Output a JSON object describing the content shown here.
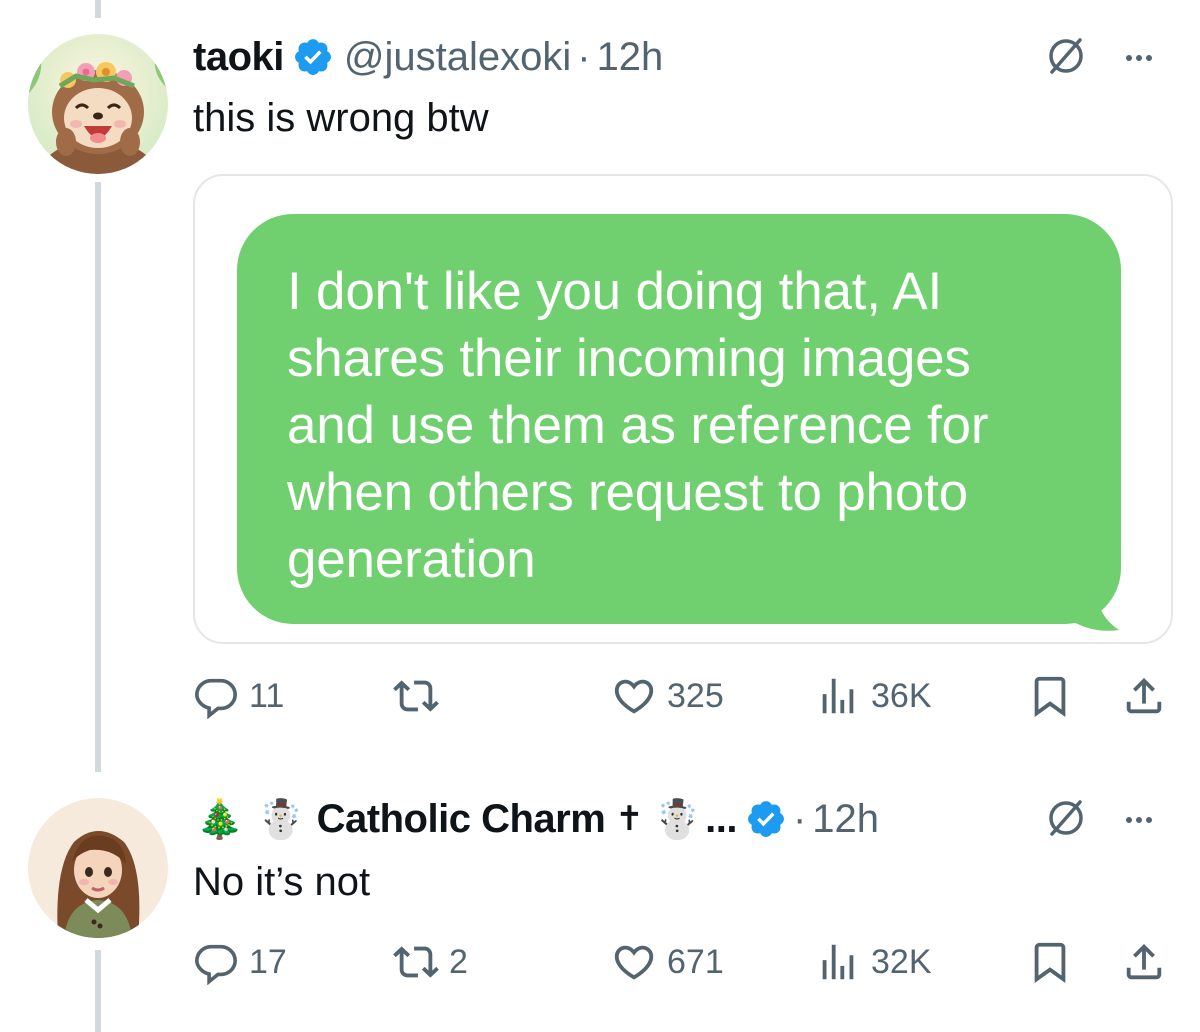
{
  "tweets": [
    {
      "display_name": "taoki",
      "handle": "@justalexoki",
      "separator": "·",
      "time": "12h",
      "text": "this is wrong btw",
      "media": {
        "bubble_text": "I don't like you doing that, AI shares their incoming images and use them as reference for when others request to photo generation",
        "bubble_color": "#70cf6f"
      },
      "stats": {
        "replies": "11",
        "reposts": "",
        "likes": "325",
        "views": "36K"
      }
    },
    {
      "display_name": "Catholic Charm",
      "name_prefix_emoji": [
        "🎄",
        "☃️"
      ],
      "name_suffix_cross": "✝",
      "name_suffix_emoji": "☃️",
      "truncation": "...",
      "separator": "·",
      "time": "12h",
      "text": "No it’s not",
      "stats": {
        "replies": "17",
        "reposts": "2",
        "likes": "671",
        "views": "32K"
      }
    }
  ],
  "colors": {
    "text_primary": "#0f1419",
    "text_secondary": "#536471",
    "verified_blue": "#1d9bf0",
    "thread_line": "#cfd9de"
  },
  "icons": [
    "verified-badge-icon",
    "grok-icon",
    "more-icon",
    "reply-icon",
    "repost-icon",
    "like-icon",
    "views-icon",
    "bookmark-icon",
    "share-icon"
  ]
}
